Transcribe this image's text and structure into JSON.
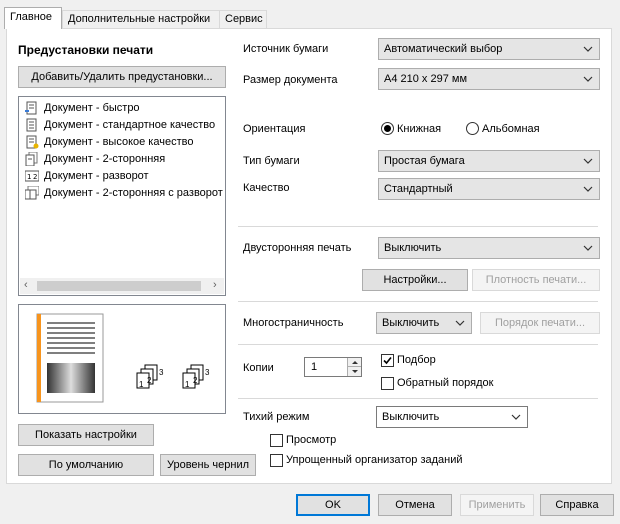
{
  "tabs": [
    {
      "label": "Главное",
      "active": true
    },
    {
      "label": "Дополнительные настройки",
      "active": false
    },
    {
      "label": "Сервис",
      "active": false
    }
  ],
  "presets": {
    "heading": "Предустановки печати",
    "add_remove_label": "Добавить/Удалить предустановки...",
    "items": [
      {
        "label": "Документ - быстро",
        "icon": "document-fast-icon"
      },
      {
        "label": "Документ - стандартное качество",
        "icon": "document-standard-icon"
      },
      {
        "label": "Документ - высокое качество",
        "icon": "document-high-quality-icon"
      },
      {
        "label": "Документ - 2-сторонняя",
        "icon": "document-2-sided-icon"
      },
      {
        "label": "Документ - разворот",
        "icon": "document-2up-icon"
      },
      {
        "label": "Документ - 2-сторонняя с разворот",
        "icon": "document-2-sided-2up-icon"
      }
    ],
    "show_settings_label": "Показать настройки",
    "defaults_label": "По умолчанию",
    "ink_levels_label": "Уровень чернил"
  },
  "preview": {
    "collate_digits": [
      "1",
      "2",
      "3"
    ]
  },
  "settings": {
    "paper_source_label": "Источник бумаги",
    "paper_source_value": "Автоматический выбор",
    "doc_size_label": "Размер документа",
    "doc_size_value": "A4 210 x 297 мм",
    "orientation_label": "Ориентация",
    "orientation_portrait": "Книжная",
    "orientation_landscape": "Альбомная",
    "paper_type_label": "Тип бумаги",
    "paper_type_value": "Простая бумага",
    "quality_label": "Качество",
    "quality_value": "Стандартный",
    "duplex_label": "Двусторонняя печать",
    "duplex_value": "Выключить",
    "duplex_settings_label": "Настройки...",
    "print_density_label": "Плотность печати...",
    "multipage_label": "Многостраничность",
    "multipage_value": "Выключить",
    "page_order_label": "Порядок печати...",
    "copies_label": "Копии",
    "copies_value": "1",
    "collate_label": "Подбор",
    "reverse_order_label": "Обратный порядок",
    "quiet_mode_label": "Тихий режим",
    "quiet_mode_value": "Выключить",
    "preview_label": "Просмотр",
    "job_arranger_label": "Упрощенный организатор заданий"
  },
  "dialog_buttons": {
    "ok": "OK",
    "cancel": "Отмена",
    "apply": "Применить",
    "help": "Справка"
  },
  "colors": {
    "accent": "#0078d7",
    "page_edge": "#f7941d"
  }
}
